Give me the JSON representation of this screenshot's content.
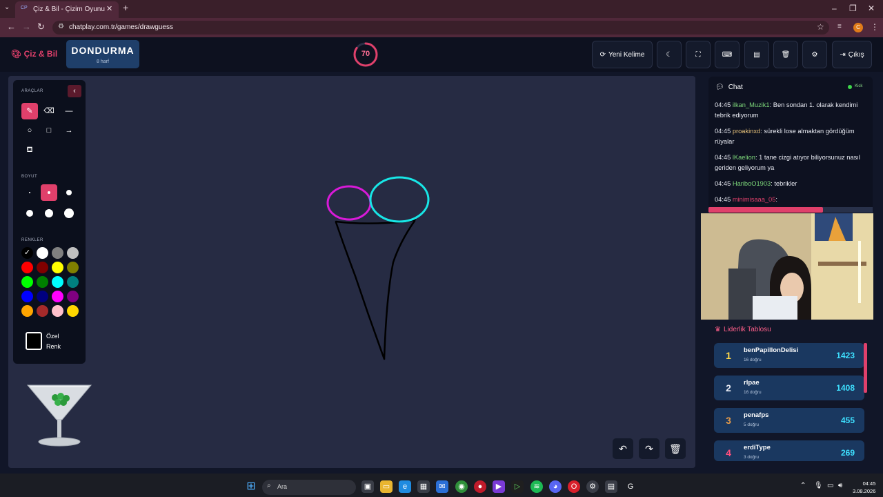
{
  "browser": {
    "tab_title": "Çiz & Bil - Çizim Oyunu",
    "tab_favicon": "CP",
    "url": "chatplay.com.tr/games/drawguess",
    "profile_letter": "C"
  },
  "header": {
    "logo": "Çiz & Bil",
    "word": "DONDURMA",
    "word_hint": "8 harf",
    "timer": "70",
    "timer_fraction": 0.85,
    "buttons": {
      "new_word": "Yeni Kelime",
      "exit": "Çıkış"
    }
  },
  "tools": {
    "tools_label": "ARAÇLAR",
    "size_label": "BOYUT",
    "colors_label": "RENKLER",
    "custom_color_line1": "Özel",
    "custom_color_line2": "Renk",
    "palette": [
      "#000000",
      "#ffffff",
      "#808080",
      "#c0c0c0",
      "#ff0000",
      "#800000",
      "#ffff00",
      "#808000",
      "#00ff00",
      "#008000",
      "#00ffff",
      "#008080",
      "#0000ff",
      "#000080",
      "#ff00ff",
      "#800080",
      "#ffa500",
      "#a52a2a",
      "#ffc0cb",
      "#ffd700"
    ],
    "selected_color": "#000000"
  },
  "chat": {
    "title": "Chat",
    "platform": "Kick",
    "messages": [
      {
        "time": "04:45",
        "user": "ilkan_Muzik1",
        "color": "#7dd87a",
        "text": ": Ben sondan 1. olarak kendimi tebrik ediyorum"
      },
      {
        "time": "04:45",
        "user": "proakinxd",
        "color": "#e7c27a",
        "text": ": sürekli lose almaktan gördüğüm rüyalar"
      },
      {
        "time": "04:45",
        "user": "lKaelion",
        "color": "#7dd87a",
        "text": ": 1 tane cizgi atıyor biliyorsunuz nasıl geriden geliyorum ya"
      },
      {
        "time": "04:45",
        "user": "HariboO1903",
        "color": "#7dd87a",
        "text": ": tebrikler"
      },
      {
        "time": "04:45",
        "user": "minimisaaa_05",
        "color": "#e0406b",
        "text": ":"
      }
    ]
  },
  "leaderboard": {
    "title": "Liderlik Tablosu",
    "rows": [
      {
        "rank": "1",
        "name": "benPapillonDelisi",
        "sub": "16 doğru",
        "score": "1423",
        "color": "#ffd84a"
      },
      {
        "rank": "2",
        "name": "rlpae",
        "sub": "16 doğru",
        "score": "1408",
        "color": "#e6e9f2"
      },
      {
        "rank": "3",
        "name": "penafps",
        "sub": "5 doğru",
        "score": "455",
        "color": "#e39a4a"
      },
      {
        "rank": "4",
        "name": "erdiType",
        "sub": "3 doğru",
        "score": "269",
        "color": "#ff4f7e"
      }
    ]
  },
  "taskbar": {
    "search": "Ara",
    "time": "04:45",
    "date": "3.08.2026"
  }
}
